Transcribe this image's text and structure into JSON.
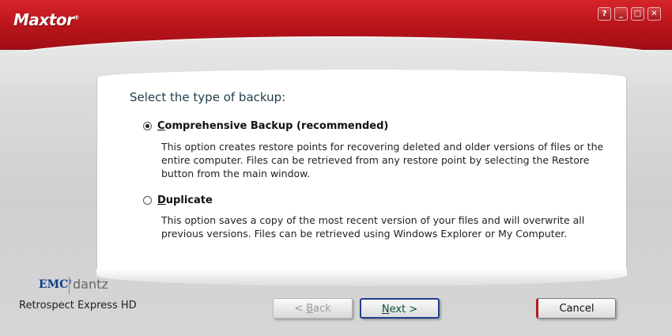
{
  "window": {
    "brand_logo": "Maxtor",
    "controls": [
      "?",
      "_",
      "□",
      "✕"
    ]
  },
  "main": {
    "heading": "Select the type of backup:",
    "options": [
      {
        "label_first": "C",
        "label_rest": "omprehensive Backup (recommended)",
        "checked": true,
        "description": "This option creates restore points for recovering deleted and older versions of files or the entire computer. Files can be retrieved from any restore point by selecting the Restore button from the main window."
      },
      {
        "label_first": "D",
        "label_rest": "uplicate",
        "checked": false,
        "description": "This option saves a copy of the most recent version of your files and will overwrite all previous versions. Files can be retrieved using Windows Explorer or My Computer."
      }
    ]
  },
  "branding": {
    "emc": "EMC",
    "emc_sup": "2",
    "dantz": "dantz",
    "product": "Retrospect Express HD"
  },
  "buttons": {
    "back_prefix": "< ",
    "back_key": "B",
    "back_rest": "ack",
    "next_key": "N",
    "next_rest": "ext >",
    "cancel": "Cancel"
  }
}
